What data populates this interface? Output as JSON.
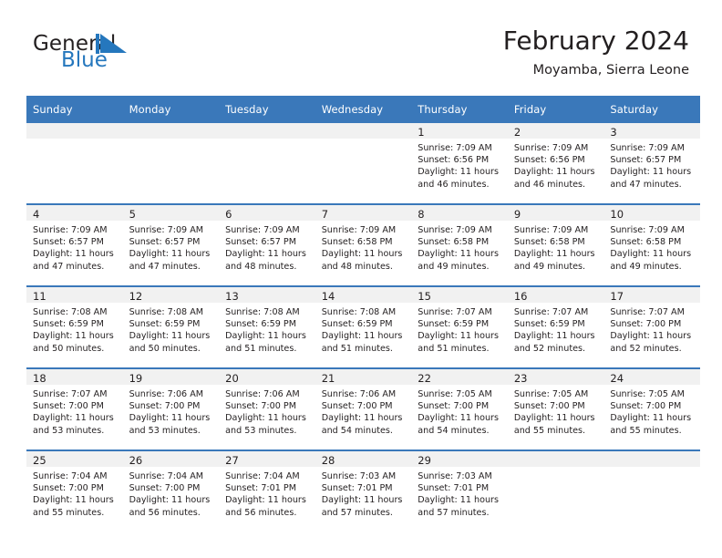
{
  "brand": {
    "name_part1": "General",
    "name_part2": "Blue",
    "logo_icon": "triangle-flag-icon",
    "accent_color": "#2577bd"
  },
  "header": {
    "title": "February 2024",
    "location": "Moyamba, Sierra Leone"
  },
  "theme": {
    "header_bar_color": "#3a78ba",
    "daynum_band_color": "#f1f1f1",
    "text_color": "#231f20"
  },
  "calendar": {
    "weekday_headers": [
      "Sunday",
      "Monday",
      "Tuesday",
      "Wednesday",
      "Thursday",
      "Friday",
      "Saturday"
    ],
    "weeks": [
      [
        {
          "day": "",
          "empty": true
        },
        {
          "day": "",
          "empty": true
        },
        {
          "day": "",
          "empty": true
        },
        {
          "day": "",
          "empty": true
        },
        {
          "day": "1",
          "sunrise": "Sunrise: 7:09 AM",
          "sunset": "Sunset: 6:56 PM",
          "daylight_1": "Daylight: 11 hours",
          "daylight_2": "and 46 minutes."
        },
        {
          "day": "2",
          "sunrise": "Sunrise: 7:09 AM",
          "sunset": "Sunset: 6:56 PM",
          "daylight_1": "Daylight: 11 hours",
          "daylight_2": "and 46 minutes."
        },
        {
          "day": "3",
          "sunrise": "Sunrise: 7:09 AM",
          "sunset": "Sunset: 6:57 PM",
          "daylight_1": "Daylight: 11 hours",
          "daylight_2": "and 47 minutes."
        }
      ],
      [
        {
          "day": "4",
          "sunrise": "Sunrise: 7:09 AM",
          "sunset": "Sunset: 6:57 PM",
          "daylight_1": "Daylight: 11 hours",
          "daylight_2": "and 47 minutes."
        },
        {
          "day": "5",
          "sunrise": "Sunrise: 7:09 AM",
          "sunset": "Sunset: 6:57 PM",
          "daylight_1": "Daylight: 11 hours",
          "daylight_2": "and 47 minutes."
        },
        {
          "day": "6",
          "sunrise": "Sunrise: 7:09 AM",
          "sunset": "Sunset: 6:57 PM",
          "daylight_1": "Daylight: 11 hours",
          "daylight_2": "and 48 minutes."
        },
        {
          "day": "7",
          "sunrise": "Sunrise: 7:09 AM",
          "sunset": "Sunset: 6:58 PM",
          "daylight_1": "Daylight: 11 hours",
          "daylight_2": "and 48 minutes."
        },
        {
          "day": "8",
          "sunrise": "Sunrise: 7:09 AM",
          "sunset": "Sunset: 6:58 PM",
          "daylight_1": "Daylight: 11 hours",
          "daylight_2": "and 49 minutes."
        },
        {
          "day": "9",
          "sunrise": "Sunrise: 7:09 AM",
          "sunset": "Sunset: 6:58 PM",
          "daylight_1": "Daylight: 11 hours",
          "daylight_2": "and 49 minutes."
        },
        {
          "day": "10",
          "sunrise": "Sunrise: 7:09 AM",
          "sunset": "Sunset: 6:58 PM",
          "daylight_1": "Daylight: 11 hours",
          "daylight_2": "and 49 minutes."
        }
      ],
      [
        {
          "day": "11",
          "sunrise": "Sunrise: 7:08 AM",
          "sunset": "Sunset: 6:59 PM",
          "daylight_1": "Daylight: 11 hours",
          "daylight_2": "and 50 minutes."
        },
        {
          "day": "12",
          "sunrise": "Sunrise: 7:08 AM",
          "sunset": "Sunset: 6:59 PM",
          "daylight_1": "Daylight: 11 hours",
          "daylight_2": "and 50 minutes."
        },
        {
          "day": "13",
          "sunrise": "Sunrise: 7:08 AM",
          "sunset": "Sunset: 6:59 PM",
          "daylight_1": "Daylight: 11 hours",
          "daylight_2": "and 51 minutes."
        },
        {
          "day": "14",
          "sunrise": "Sunrise: 7:08 AM",
          "sunset": "Sunset: 6:59 PM",
          "daylight_1": "Daylight: 11 hours",
          "daylight_2": "and 51 minutes."
        },
        {
          "day": "15",
          "sunrise": "Sunrise: 7:07 AM",
          "sunset": "Sunset: 6:59 PM",
          "daylight_1": "Daylight: 11 hours",
          "daylight_2": "and 51 minutes."
        },
        {
          "day": "16",
          "sunrise": "Sunrise: 7:07 AM",
          "sunset": "Sunset: 6:59 PM",
          "daylight_1": "Daylight: 11 hours",
          "daylight_2": "and 52 minutes."
        },
        {
          "day": "17",
          "sunrise": "Sunrise: 7:07 AM",
          "sunset": "Sunset: 7:00 PM",
          "daylight_1": "Daylight: 11 hours",
          "daylight_2": "and 52 minutes."
        }
      ],
      [
        {
          "day": "18",
          "sunrise": "Sunrise: 7:07 AM",
          "sunset": "Sunset: 7:00 PM",
          "daylight_1": "Daylight: 11 hours",
          "daylight_2": "and 53 minutes."
        },
        {
          "day": "19",
          "sunrise": "Sunrise: 7:06 AM",
          "sunset": "Sunset: 7:00 PM",
          "daylight_1": "Daylight: 11 hours",
          "daylight_2": "and 53 minutes."
        },
        {
          "day": "20",
          "sunrise": "Sunrise: 7:06 AM",
          "sunset": "Sunset: 7:00 PM",
          "daylight_1": "Daylight: 11 hours",
          "daylight_2": "and 53 minutes."
        },
        {
          "day": "21",
          "sunrise": "Sunrise: 7:06 AM",
          "sunset": "Sunset: 7:00 PM",
          "daylight_1": "Daylight: 11 hours",
          "daylight_2": "and 54 minutes."
        },
        {
          "day": "22",
          "sunrise": "Sunrise: 7:05 AM",
          "sunset": "Sunset: 7:00 PM",
          "daylight_1": "Daylight: 11 hours",
          "daylight_2": "and 54 minutes."
        },
        {
          "day": "23",
          "sunrise": "Sunrise: 7:05 AM",
          "sunset": "Sunset: 7:00 PM",
          "daylight_1": "Daylight: 11 hours",
          "daylight_2": "and 55 minutes."
        },
        {
          "day": "24",
          "sunrise": "Sunrise: 7:05 AM",
          "sunset": "Sunset: 7:00 PM",
          "daylight_1": "Daylight: 11 hours",
          "daylight_2": "and 55 minutes."
        }
      ],
      [
        {
          "day": "25",
          "sunrise": "Sunrise: 7:04 AM",
          "sunset": "Sunset: 7:00 PM",
          "daylight_1": "Daylight: 11 hours",
          "daylight_2": "and 55 minutes."
        },
        {
          "day": "26",
          "sunrise": "Sunrise: 7:04 AM",
          "sunset": "Sunset: 7:00 PM",
          "daylight_1": "Daylight: 11 hours",
          "daylight_2": "and 56 minutes."
        },
        {
          "day": "27",
          "sunrise": "Sunrise: 7:04 AM",
          "sunset": "Sunset: 7:01 PM",
          "daylight_1": "Daylight: 11 hours",
          "daylight_2": "and 56 minutes."
        },
        {
          "day": "28",
          "sunrise": "Sunrise: 7:03 AM",
          "sunset": "Sunset: 7:01 PM",
          "daylight_1": "Daylight: 11 hours",
          "daylight_2": "and 57 minutes."
        },
        {
          "day": "29",
          "sunrise": "Sunrise: 7:03 AM",
          "sunset": "Sunset: 7:01 PM",
          "daylight_1": "Daylight: 11 hours",
          "daylight_2": "and 57 minutes."
        },
        {
          "day": "",
          "empty": true
        },
        {
          "day": "",
          "empty": true
        }
      ]
    ]
  }
}
